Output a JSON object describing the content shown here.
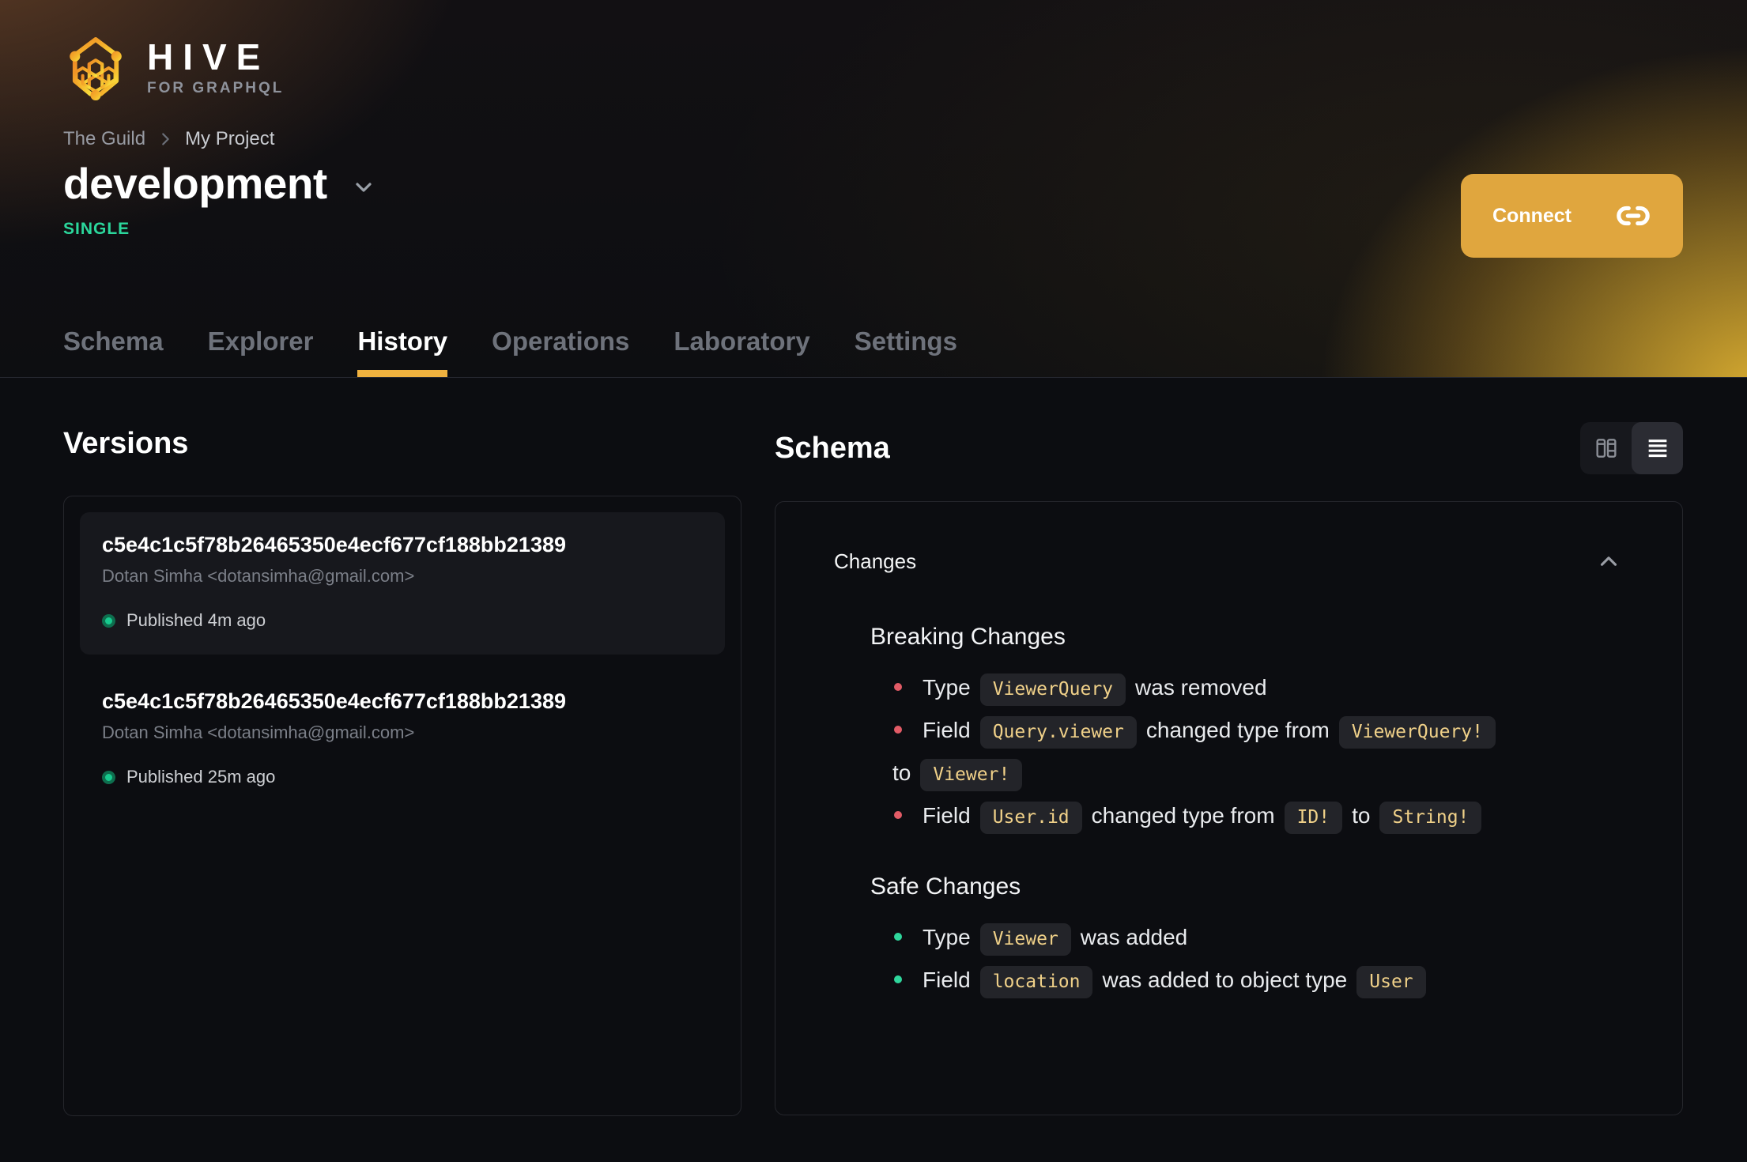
{
  "brand": {
    "name": "HIVE",
    "tagline": "FOR GRAPHQL"
  },
  "breadcrumb": {
    "org": "The Guild",
    "project": "My Project"
  },
  "project": {
    "title": "development",
    "badge": "SINGLE"
  },
  "connect": {
    "label": "Connect"
  },
  "tabs": {
    "active": "History",
    "items": [
      {
        "label": "Schema"
      },
      {
        "label": "Explorer"
      },
      {
        "label": "History"
      },
      {
        "label": "Operations"
      },
      {
        "label": "Laboratory"
      },
      {
        "label": "Settings"
      }
    ]
  },
  "versions": {
    "heading": "Versions",
    "items": [
      {
        "hash": "c5e4c1c5f78b26465350e4ecf677cf188bb21389",
        "author": "Dotan Simha <dotansimha@gmail.com>",
        "status": "Published 4m ago"
      },
      {
        "hash": "c5e4c1c5f78b26465350e4ecf677cf188bb21389",
        "author": "Dotan Simha <dotansimha@gmail.com>",
        "status": "Published 25m ago"
      }
    ]
  },
  "schema": {
    "heading": "Schema",
    "changes_label": "Changes",
    "breaking": {
      "title": "Breaking Changes",
      "items": [
        {
          "s0": "Type",
          "s1": "ViewerQuery",
          "s2": "was removed"
        },
        {
          "s0": "Field",
          "s1": "Query.viewer",
          "s2": "changed type from",
          "s3": "ViewerQuery!",
          "s4": "to",
          "s5": "Viewer!"
        },
        {
          "s0": "Field",
          "s1": "User.id",
          "s2": "changed type from",
          "s3": "ID!",
          "s4": "to",
          "s5": "String!"
        }
      ]
    },
    "safe": {
      "title": "Safe Changes",
      "items": [
        {
          "s0": "Type",
          "s1": "Viewer",
          "s2": "was added"
        },
        {
          "s0": "Field",
          "s1": "location",
          "s2": "was added to object type",
          "s3": "User"
        }
      ]
    }
  },
  "colors": {
    "accent": "#e0a63e",
    "tab_underline": "#f0b23f",
    "single_badge": "#2bd79c",
    "breaking_bullet": "#e25b66",
    "safe_bullet": "#2fd69c",
    "chip_text": "#f0d189",
    "chip_bg": "#232429",
    "card_bg": "#17181d",
    "page_bg": "#0c0d11"
  }
}
